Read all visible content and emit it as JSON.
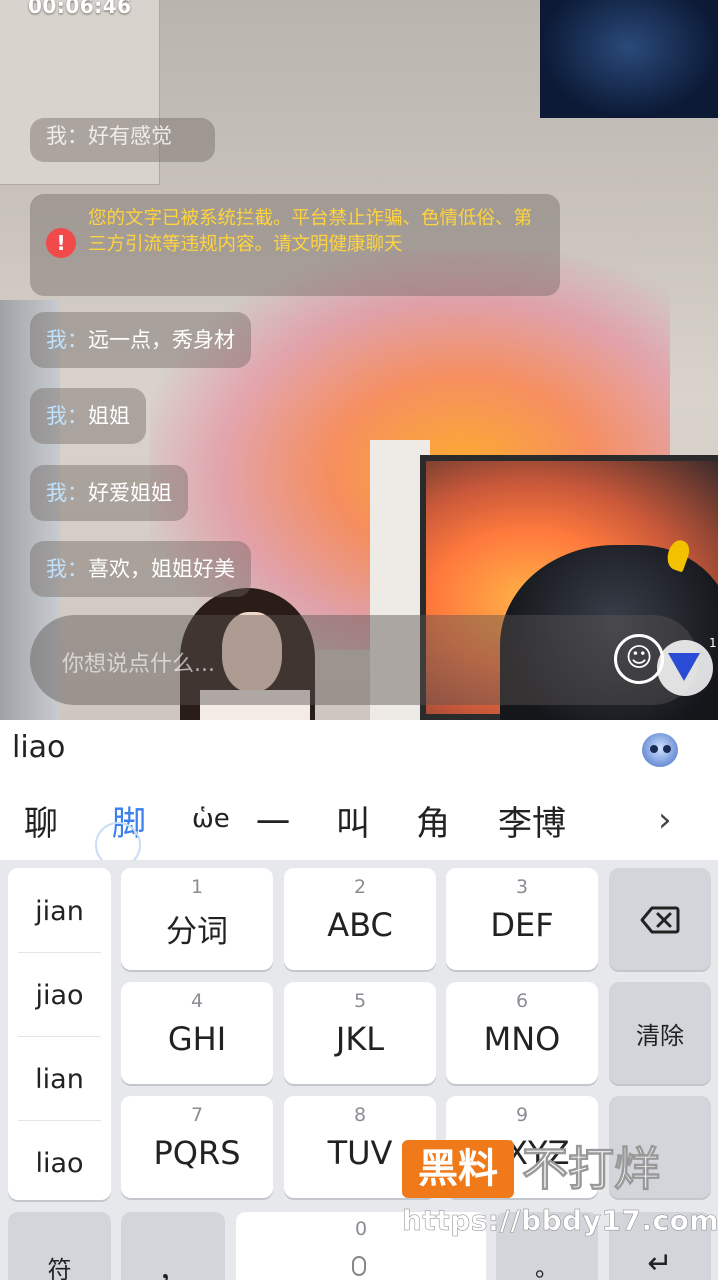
{
  "status": {
    "time": "00:06:46"
  },
  "chat": {
    "cut_message": "我：好有感觉",
    "notice": "您的文字已被系统拦截。平台禁止诈骗、色情低俗、第三方引流等违规内容。请文明健康聊天",
    "messages": [
      {
        "prefix": "我：",
        "text": "远一点，秀身材"
      },
      {
        "prefix": "我：",
        "text": "姐姐"
      },
      {
        "prefix": "我：",
        "text": "好爱姐姐"
      },
      {
        "prefix": "我：",
        "text": "喜欢，姐姐好美"
      }
    ],
    "input_placeholder": "你想说点什么...",
    "emoji_glyph": "☺",
    "badge_count": "1"
  },
  "ime": {
    "composing": "liao",
    "candidates": [
      "聊",
      "脚",
      "ὡe",
      "一",
      "叫",
      "角",
      "李博"
    ],
    "more": "›",
    "pinyin": [
      "jian",
      "jiao",
      "lian",
      "liao"
    ],
    "keys": [
      {
        "num": "1",
        "label": "分词"
      },
      {
        "num": "2",
        "label": "ABC"
      },
      {
        "num": "3",
        "label": "DEF"
      },
      {
        "num": "4",
        "label": "GHI"
      },
      {
        "num": "5",
        "label": "JKL"
      },
      {
        "num": "6",
        "label": "MNO"
      },
      {
        "num": "7",
        "label": "PQRS"
      },
      {
        "num": "8",
        "label": "TUV"
      },
      {
        "num": "9",
        "label": "WXYZ"
      }
    ],
    "clear": "清除",
    "symbol": "符",
    "comma": "，",
    "zero": "0",
    "period": "。",
    "enter": "↵"
  },
  "watermark": {
    "box": "黑料",
    "text": "不打烊",
    "url": "https://bbdy17.com"
  }
}
